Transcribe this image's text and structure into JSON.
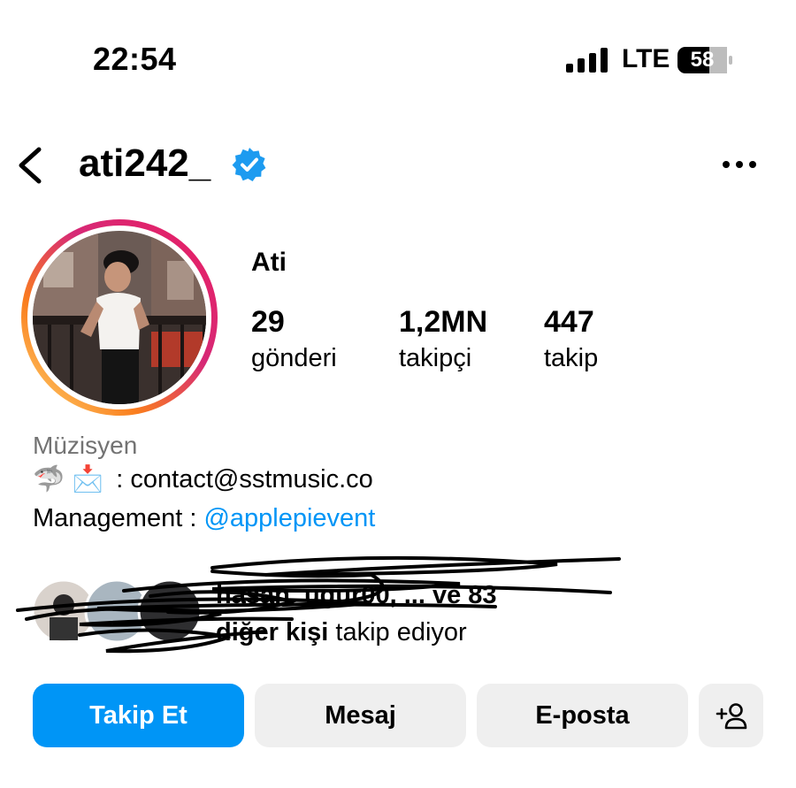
{
  "status_bar": {
    "time": "22:54",
    "network": "LTE",
    "battery": "58"
  },
  "header": {
    "username": "ati242_",
    "verified_icon": "verified-badge-icon",
    "back_icon": "chevron-left-icon",
    "more_icon": "more-horizontal-icon"
  },
  "profile": {
    "display_name": "Ati",
    "stats": [
      {
        "value": "29",
        "label": "gönderi"
      },
      {
        "value": "1,2MN",
        "label": "takipçi"
      },
      {
        "value": "447",
        "label": "takip"
      }
    ],
    "category": "Müzisyen",
    "bio_line1_emojis": "🦈 📩",
    "bio_line1_text": ": contact@sstmusic.co",
    "bio_line2_prefix": "Management : ",
    "bio_line2_mention": "@applepievent"
  },
  "followed_by": {
    "line1_redacted": "hasan_ugur00, ...",
    "line1_suffix": " ve 83",
    "line2_bold": "diğer kişi",
    "line2_suffix": " takip ediyor"
  },
  "actions": {
    "follow": "Takip Et",
    "message": "Mesaj",
    "email": "E-posta",
    "add_user_icon": "add-person-icon"
  },
  "colors": {
    "accent_blue": "#0095f6",
    "secondary_button": "#efefef",
    "category_gray": "#737373",
    "verified_blue": "#1d9bf0"
  }
}
